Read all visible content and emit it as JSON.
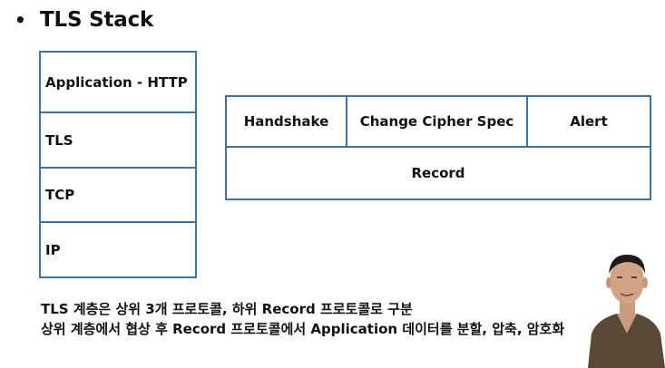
{
  "slide": {
    "bullet": "•",
    "title": "TLS Stack"
  },
  "left_stack": {
    "layers": [
      "Application - HTTP",
      "TLS",
      "TCP",
      "IP"
    ]
  },
  "tls_stack": {
    "protocols": [
      "Handshake",
      "Change Cipher Spec",
      "Alert"
    ],
    "record": "Record"
  },
  "captions": [
    "TLS  계층은 상위 3개 프로토콜, 하위 Record 프로토콜로 구분",
    "상위 계층에서 협상 후 Record 프로토콜에서 Application 데이터를 분할, 압축, 암호화"
  ],
  "colors": {
    "box_border": "#3d6fa8",
    "text": "#111111"
  }
}
